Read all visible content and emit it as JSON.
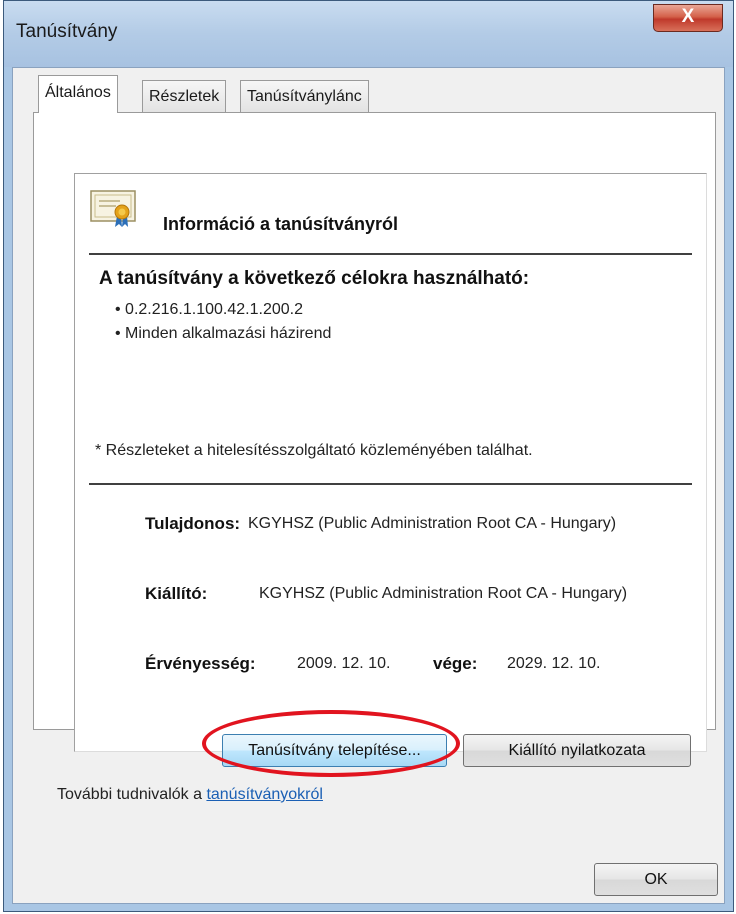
{
  "window": {
    "title": "Tanúsítvány",
    "close_label": "X"
  },
  "tabs": [
    {
      "label": "Általános",
      "active": true
    },
    {
      "label": "Részletek",
      "active": false
    },
    {
      "label": "Tanúsítványlánc",
      "active": false
    }
  ],
  "info": {
    "title": "Információ a tanúsítványról",
    "purpose_heading": "A tanúsítvány a következő célokra használható:",
    "purposes": [
      "0.2.216.1.100.42.1.200.2",
      "Minden alkalmazási házirend"
    ],
    "footnote": "* Részleteket a hitelesítésszolgáltató közleményében találhat.",
    "owner_label": "Tulajdonos:",
    "owner_value": "KGYHSZ (Public Administration Root CA - Hungary)",
    "issuer_label": "Kiállító:",
    "issuer_value": "KGYHSZ (Public Administration Root CA - Hungary)",
    "validity_label": "Érvényesség:",
    "validity_from": "2009. 12. 10.",
    "validity_to_label": "vége:",
    "validity_to": "2029. 12. 10."
  },
  "buttons": {
    "install": "Tanúsítvány telepítése...",
    "issuer_statement": "Kiállító nyilatkozata",
    "ok": "OK"
  },
  "more_info": {
    "prefix": "További tudnivalók a ",
    "link": "tanúsítványokról"
  },
  "colors": {
    "link": "#1a5fb4",
    "highlight_ellipse": "#e1141f",
    "title_bar": "#b3cbe6"
  }
}
